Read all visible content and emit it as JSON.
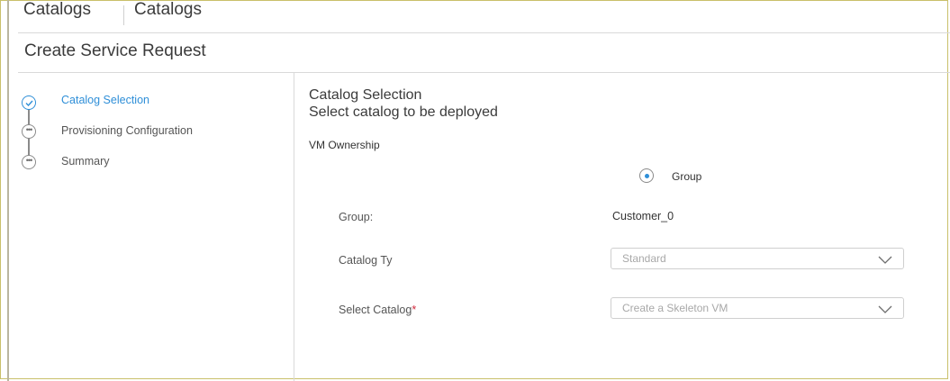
{
  "topbar": {
    "tab_primary": "Catalogs",
    "tab_secondary": "Catalogs"
  },
  "header": {
    "title": "Create Service Request"
  },
  "stepper": {
    "steps": [
      {
        "label": "Catalog Selection",
        "state": "active",
        "icon": "check-circle-icon"
      },
      {
        "label": "Provisioning Configuration",
        "state": "pending",
        "icon": "ellipsis-circle-icon"
      },
      {
        "label": "Summary",
        "state": "pending",
        "icon": "ellipsis-circle-icon"
      }
    ]
  },
  "panel": {
    "title": "Catalog Selection",
    "subtitle": "Select catalog to be deployed",
    "vm_ownership_label": "VM Ownership",
    "ownership_option": {
      "label": "Group",
      "selected": true
    },
    "fields": {
      "group": {
        "label": "Group:",
        "value": "Customer_0"
      },
      "catalog_type": {
        "label": "Catalog Ty",
        "value": "Standard"
      },
      "select_catalog": {
        "label": "Select Catalog",
        "required_mark": "*",
        "value": "Create a Skeleton VM"
      }
    }
  },
  "colors": {
    "accent": "#2f8fd8",
    "required": "#d0283c",
    "divider": "#d9d9d9"
  }
}
